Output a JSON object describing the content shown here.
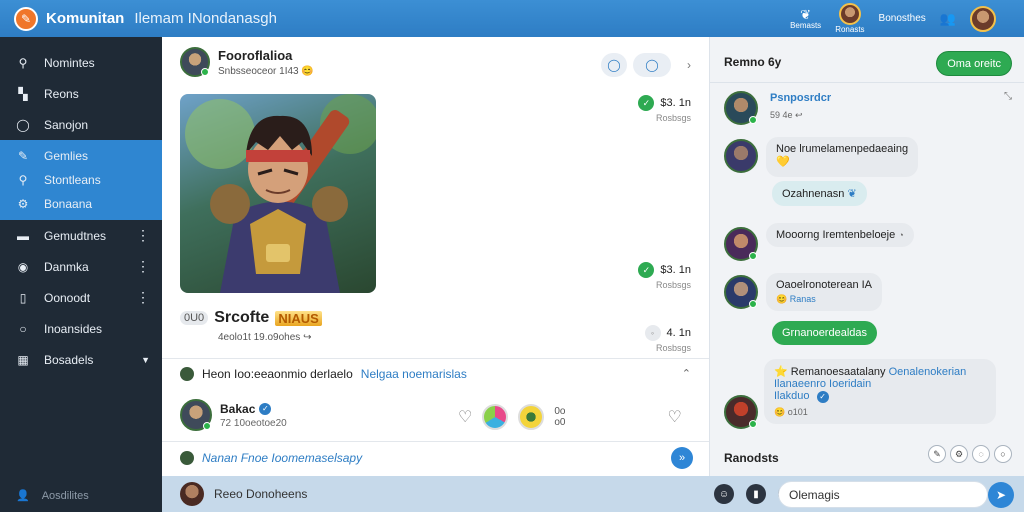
{
  "topbar": {
    "app_title": "Komunitan",
    "app_subtitle": "Ilemam INondanasgh",
    "icon1_label": "Bemasts",
    "icon2_label": "Ronasts",
    "user_label": "Bonosthes"
  },
  "sidebar": {
    "items": [
      {
        "label": "Nomintes"
      },
      {
        "label": "Reons"
      },
      {
        "label": "Sanojon"
      },
      {
        "label": "Gemlies"
      },
      {
        "label": "Stontleans"
      },
      {
        "label": "Bonaana"
      },
      {
        "label": "Gemudtnes"
      },
      {
        "label": "Danmka"
      },
      {
        "label": "Oonoodt"
      },
      {
        "label": "Inoansides"
      },
      {
        "label": "Bosadels"
      }
    ],
    "footer": "Aosdilites"
  },
  "post": {
    "author": "Fooroflalioa",
    "meta": "Snbsseoceor 1I43",
    "stats": [
      {
        "value": "$3. 1n",
        "label": "Rosbsgs"
      },
      {
        "value": "$3. 1n",
        "label": "Rosbsgs"
      },
      {
        "value": "4. 1n",
        "label": "Rosbsgs"
      }
    ],
    "game_tag": "0U0",
    "game_title": "Srcofte",
    "game_badge": "NIAUS",
    "game_meta": "4eolo1t 19.o9ohes",
    "comment_section": "Heon Ioo:eeaonmio derlaelo",
    "comment_section_link": "Nelgaa noemarislas",
    "comment": {
      "name": "Bakac",
      "meta": "72 10oeotoe20",
      "count_top": "0o",
      "count_bottom": "o0"
    },
    "reply_link": "Nanan Fnoe Ioomemaselsapy"
  },
  "right_panel": {
    "title": "Remno 6y",
    "button": "Oma oreitc",
    "messages": [
      {
        "name": "Psnposrdcr",
        "meta": "59 4e"
      },
      {
        "text": "Noe lrumelamenpedaeaing"
      },
      {
        "text": "Ozahnenasn"
      },
      {
        "text": "Mooorng Iremtenbeloeje"
      },
      {
        "text": "Oaoelronoterean IA",
        "meta": "Ranas"
      },
      {
        "text": "Grnanoerdealdas"
      },
      {
        "text": "Remanoesaatalany",
        "link": "Oenalenokerian",
        "line2": "Ilanaeenro Ioeridain",
        "line3": "Ilakduo",
        "meta": "o101"
      }
    ],
    "footer": "Ranodsts"
  },
  "bottombar": {
    "text": "Reeo Donoheens",
    "input_value": "Olemagis"
  },
  "colors": {
    "topbar": "#2e7dc4",
    "sidebar": "#1f2a36",
    "sidebar_active": "#2f86d1",
    "accent_green": "#2eaa52"
  }
}
